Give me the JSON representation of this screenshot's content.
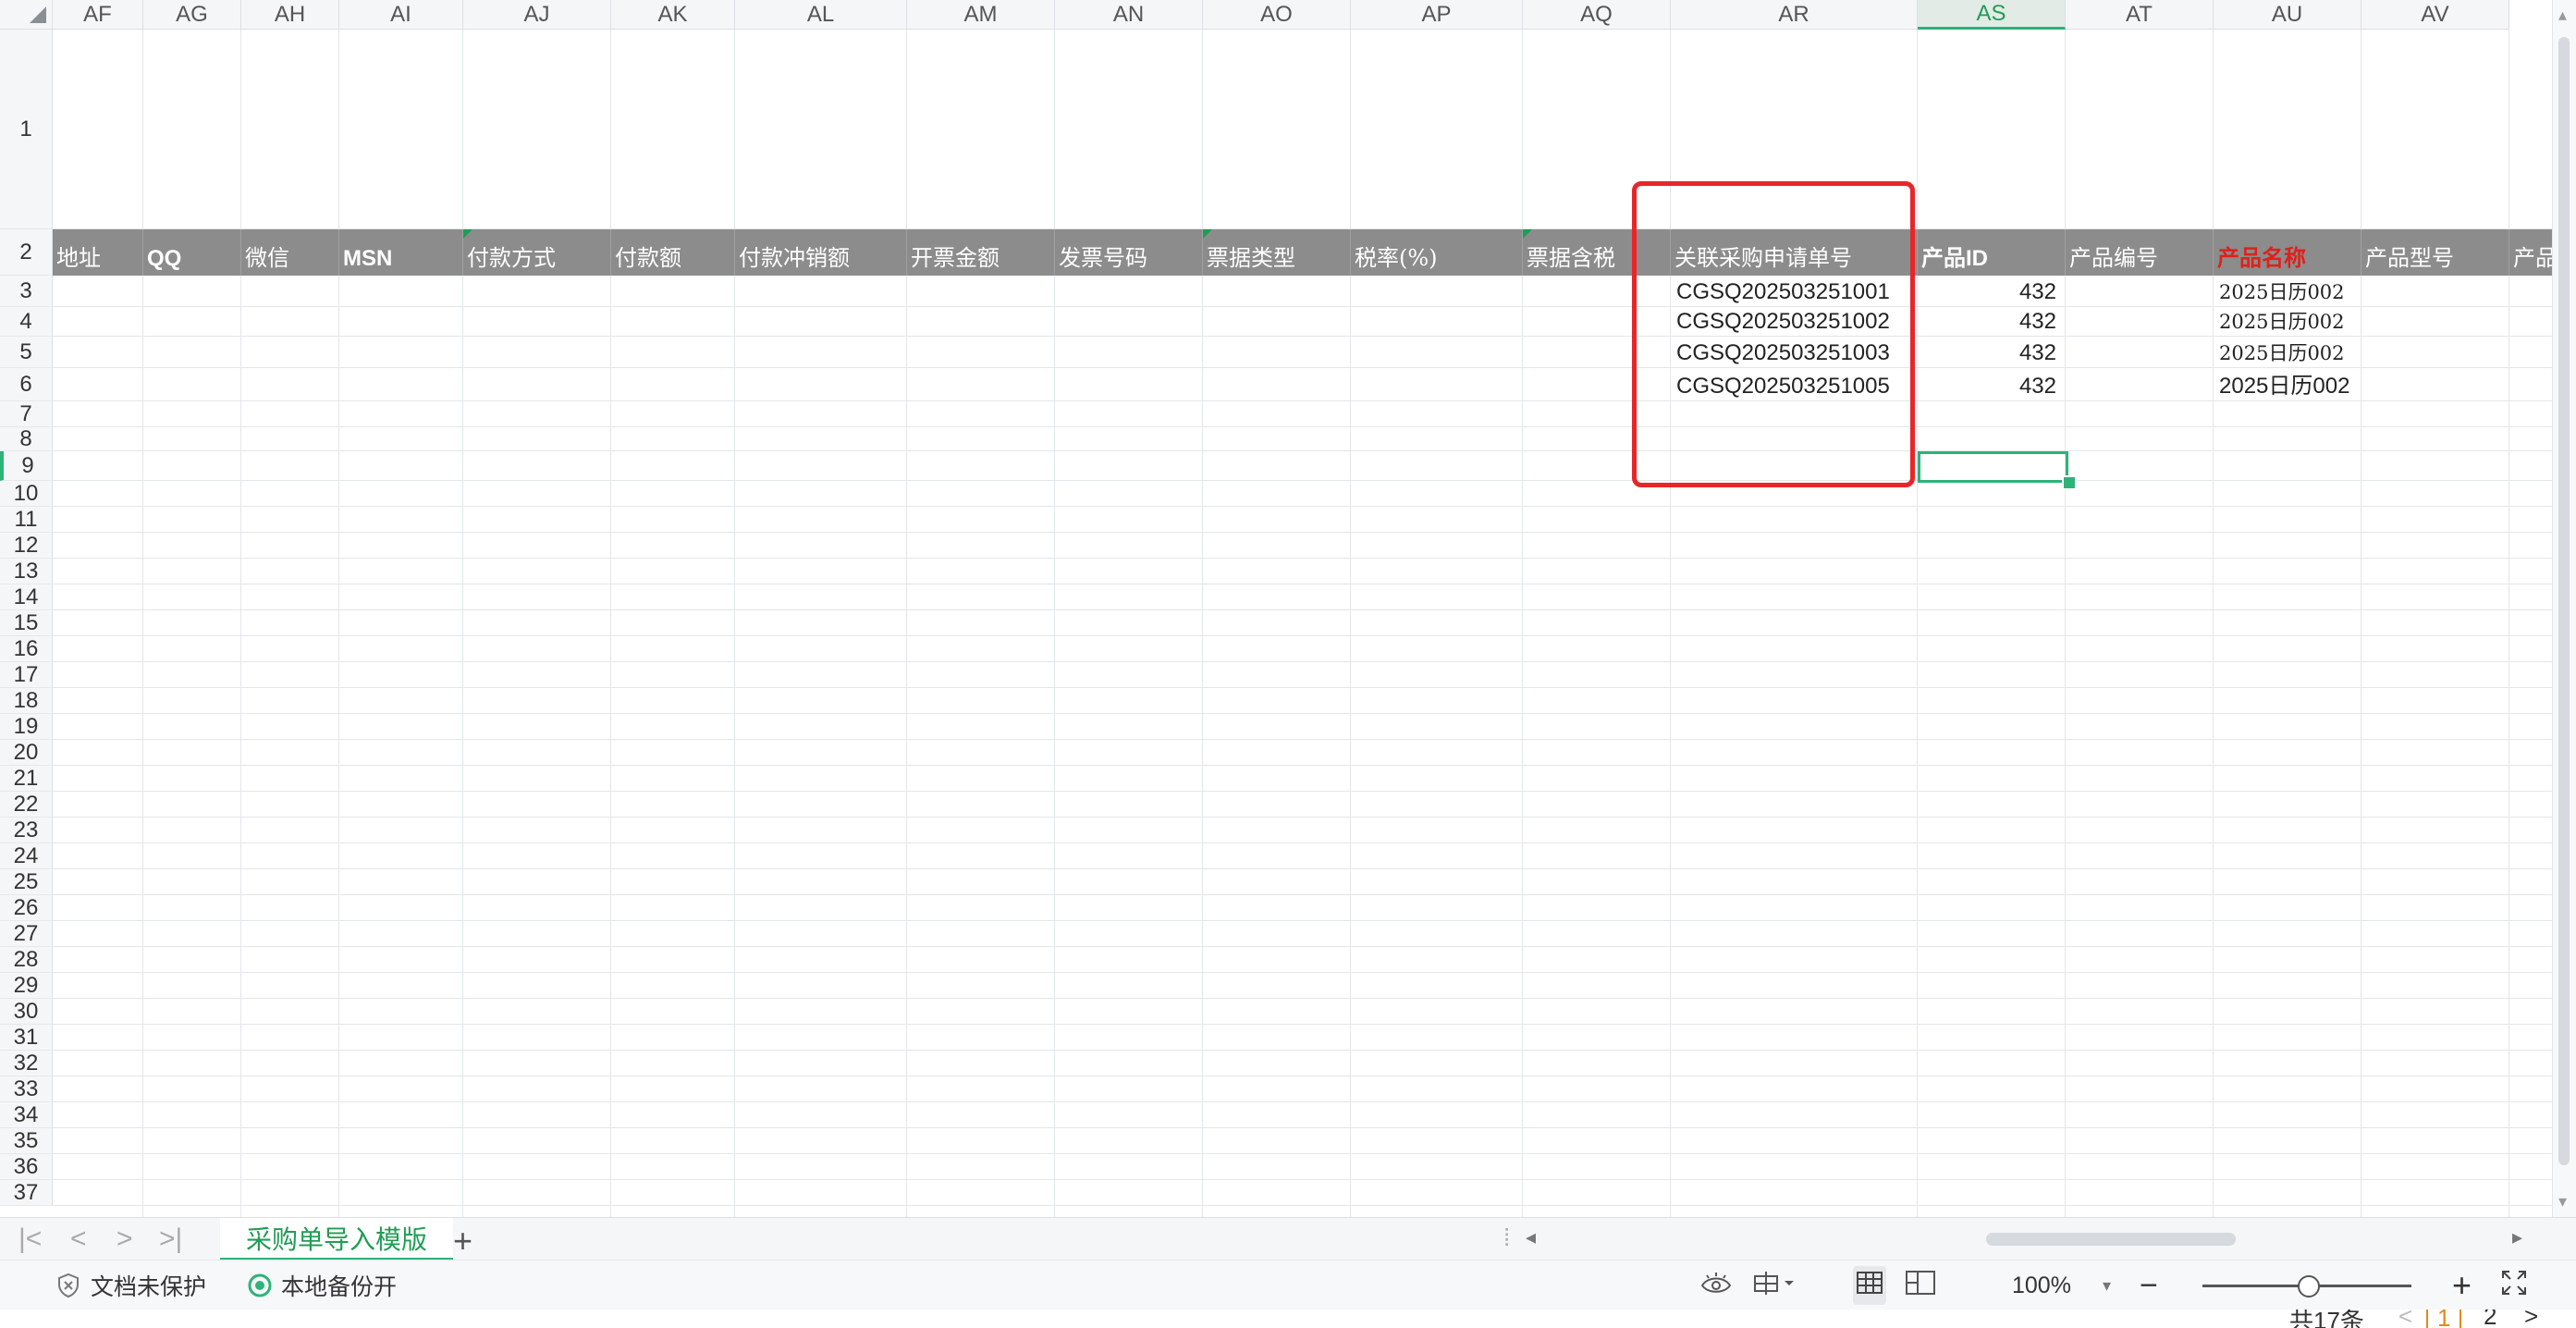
{
  "columns": [
    "AF",
    "AG",
    "AH",
    "AI",
    "AJ",
    "AK",
    "AL",
    "AM",
    "AN",
    "AO",
    "AP",
    "AQ",
    "AR",
    "AS",
    "AT",
    "AU",
    "AV"
  ],
  "selected_column": "AS",
  "rows": [
    "1",
    "2",
    "3",
    "4",
    "5",
    "6",
    "7",
    "8",
    "9",
    "10",
    "11",
    "12",
    "13",
    "14",
    "15",
    "16",
    "17",
    "18",
    "19",
    "20",
    "21",
    "22",
    "23",
    "24",
    "25",
    "26",
    "27",
    "28",
    "29",
    "30",
    "31",
    "32",
    "33",
    "34",
    "35",
    "36",
    "37"
  ],
  "active_row": "9",
  "header_row": {
    "AF": "地址",
    "AG": "QQ",
    "AH": "微信",
    "AI": "MSN",
    "AJ": "付款方式",
    "AK": "付款额",
    "AL": "付款冲销额",
    "AM": "开票金额",
    "AN": "发票号码",
    "AO": "票据类型",
    "AP": "税率(%)",
    "AQ": "票据含税",
    "AR": "关联采购申请单号",
    "AS": "产品ID",
    "AT": "产品编号",
    "AU": "产品名称",
    "AV": "产品型号",
    "AW": "产品"
  },
  "data_rows": [
    {
      "row": "3",
      "AR": "CGSQ202503251001",
      "AS": "432",
      "AU": "2025日历002"
    },
    {
      "row": "4",
      "AR": "CGSQ202503251002",
      "AS": "432",
      "AU": "2025日历002"
    },
    {
      "row": "5",
      "AR": "CGSQ202503251003",
      "AS": "432",
      "AU": "2025日历002"
    },
    {
      "row": "6",
      "AR": "CGSQ202503251005",
      "AS": "432",
      "AU": "2025日历002"
    }
  ],
  "sheet_tab": "采购单导入模版",
  "add_sheet": "+",
  "status": {
    "protect": "文档未保护",
    "backup": "本地备份开",
    "zoom": "100%",
    "zoom_minus": "−",
    "zoom_plus": "+"
  },
  "pager": {
    "total": "共17条",
    "page1": "1",
    "page2": "2",
    "next": ">"
  },
  "colors": {
    "accent": "#2db37a",
    "header_band": "#8c8c8c",
    "highlight": "#e8262a"
  }
}
